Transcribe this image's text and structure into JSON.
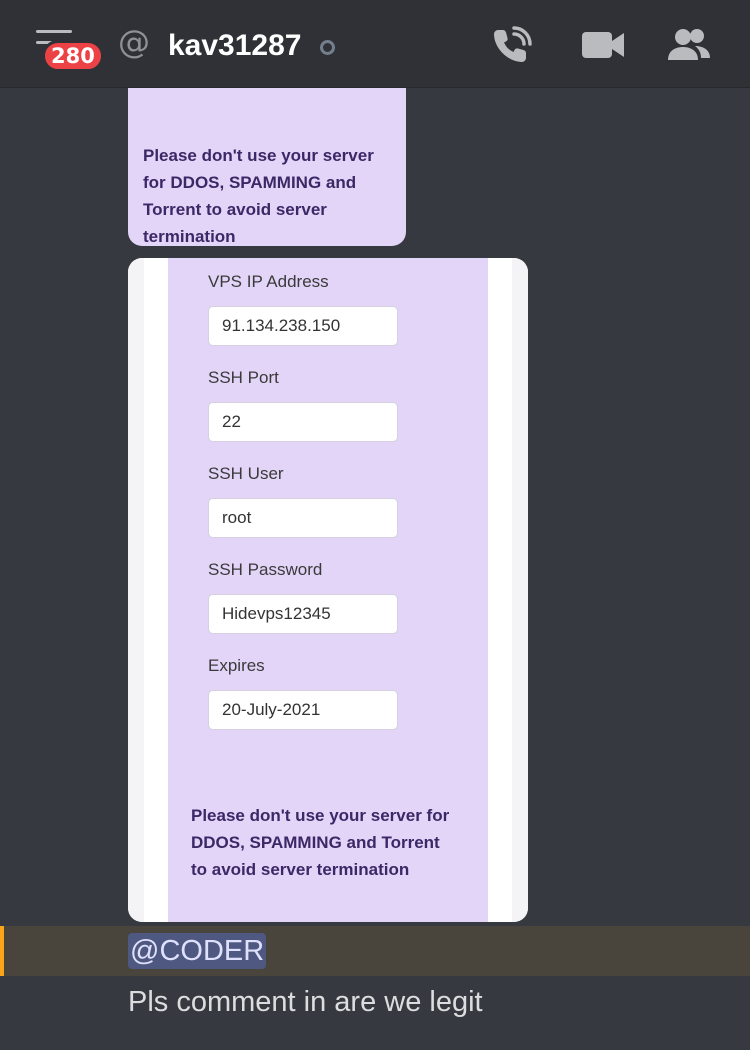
{
  "header": {
    "unread_count": "280",
    "channel_prefix": "@",
    "username": "kav31287",
    "status": "offline",
    "icons": [
      "hamburger-menu-icon",
      "at-icon",
      "call-icon",
      "video-icon",
      "members-icon"
    ]
  },
  "messages": {
    "card_top": {
      "notice": "Please don't use your server for DDOS, SPAMMING and Torrent to avoid server termination"
    },
    "card_main": {
      "fields": [
        {
          "label": "VPS IP Address",
          "value": "91.134.238.150"
        },
        {
          "label": "SSH Port",
          "value": "22"
        },
        {
          "label": "SSH User",
          "value": "root"
        },
        {
          "label": "SSH Password",
          "value": "Hidevps12345"
        },
        {
          "label": "Expires",
          "value": "20-July-2021"
        }
      ],
      "notice": "Please don't use your server for DDOS, SPAMMING and Torrent to avoid server termination"
    },
    "mention": "@CODER",
    "text": "Pls comment in are we legit"
  },
  "colors": {
    "background": "#36393f",
    "header": "#2f3136",
    "badge": "#ed4245",
    "card_purple": "#e3d5f8",
    "mention_bar": "#faa61a",
    "mention_highlight": "#4f5880"
  }
}
